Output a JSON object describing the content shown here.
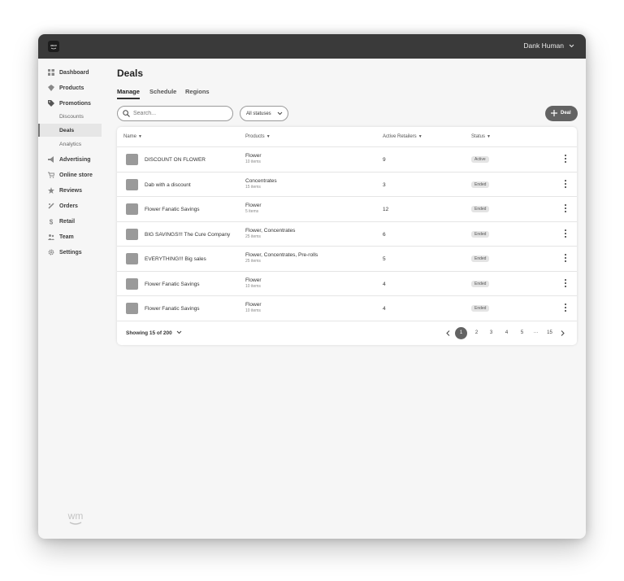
{
  "topbar": {
    "user_name": "Dank Human",
    "logo_text": "WEED MAPS"
  },
  "sidebar": {
    "items": [
      {
        "label": "Dashboard",
        "icon": "dashboard-icon"
      },
      {
        "label": "Products",
        "icon": "products-icon"
      },
      {
        "label": "Promotions",
        "icon": "tag-icon"
      },
      {
        "label": "Discounts"
      },
      {
        "label": "Deals",
        "active": true
      },
      {
        "label": "Analytics"
      },
      {
        "label": "Advertising",
        "icon": "megaphone-icon"
      },
      {
        "label": "Online store",
        "icon": "cart-icon"
      },
      {
        "label": "Reviews",
        "icon": "star-icon"
      },
      {
        "label": "Orders",
        "icon": "orders-icon"
      },
      {
        "label": "Retail",
        "icon": "dollar-icon"
      },
      {
        "label": "Team",
        "icon": "team-icon"
      },
      {
        "label": "Settings",
        "icon": "gear-icon"
      }
    ],
    "footer_logo": "wm"
  },
  "main": {
    "title": "Deals",
    "tabs": [
      "Manage",
      "Schedule",
      "Regions"
    ],
    "search_placeholder": "Search...",
    "status_filter": "All statuses",
    "add_button": "Deal",
    "columns": [
      "Name",
      "Products",
      "Active Retailers",
      "Status"
    ],
    "rows": [
      {
        "name": "DISCOUNT ON FLOWER",
        "products": "Flower",
        "items": "10 items",
        "retailers": "9",
        "status": "Active"
      },
      {
        "name": "Dab with a discount",
        "products": "Concentrates",
        "items": "15 items",
        "retailers": "3",
        "status": "Ended"
      },
      {
        "name": "Flower Fanatic Savings",
        "products": "Flower",
        "items": "5 items",
        "retailers": "12",
        "status": "Ended"
      },
      {
        "name": "BIG SAVINGS!!! The Cure Company",
        "products": "Flower, Concentrates",
        "items": "25 items",
        "retailers": "6",
        "status": "Ended"
      },
      {
        "name": "EVERYTHING!!! Big sales",
        "products": "Flower, Concentrates, Pre-rolls",
        "items": "25 items",
        "retailers": "5",
        "status": "Ended"
      },
      {
        "name": "Flower Fanatic Savings",
        "products": "Flower",
        "items": "10 items",
        "retailers": "4",
        "status": "Ended"
      },
      {
        "name": "Flower Fanatic Savings",
        "products": "Flower",
        "items": "10 items",
        "retailers": "4",
        "status": "Ended"
      }
    ],
    "showing": "Showing 15 of 200",
    "pages": [
      "1",
      "2",
      "3",
      "4",
      "5",
      "···",
      "15"
    ],
    "current_page": "1"
  }
}
